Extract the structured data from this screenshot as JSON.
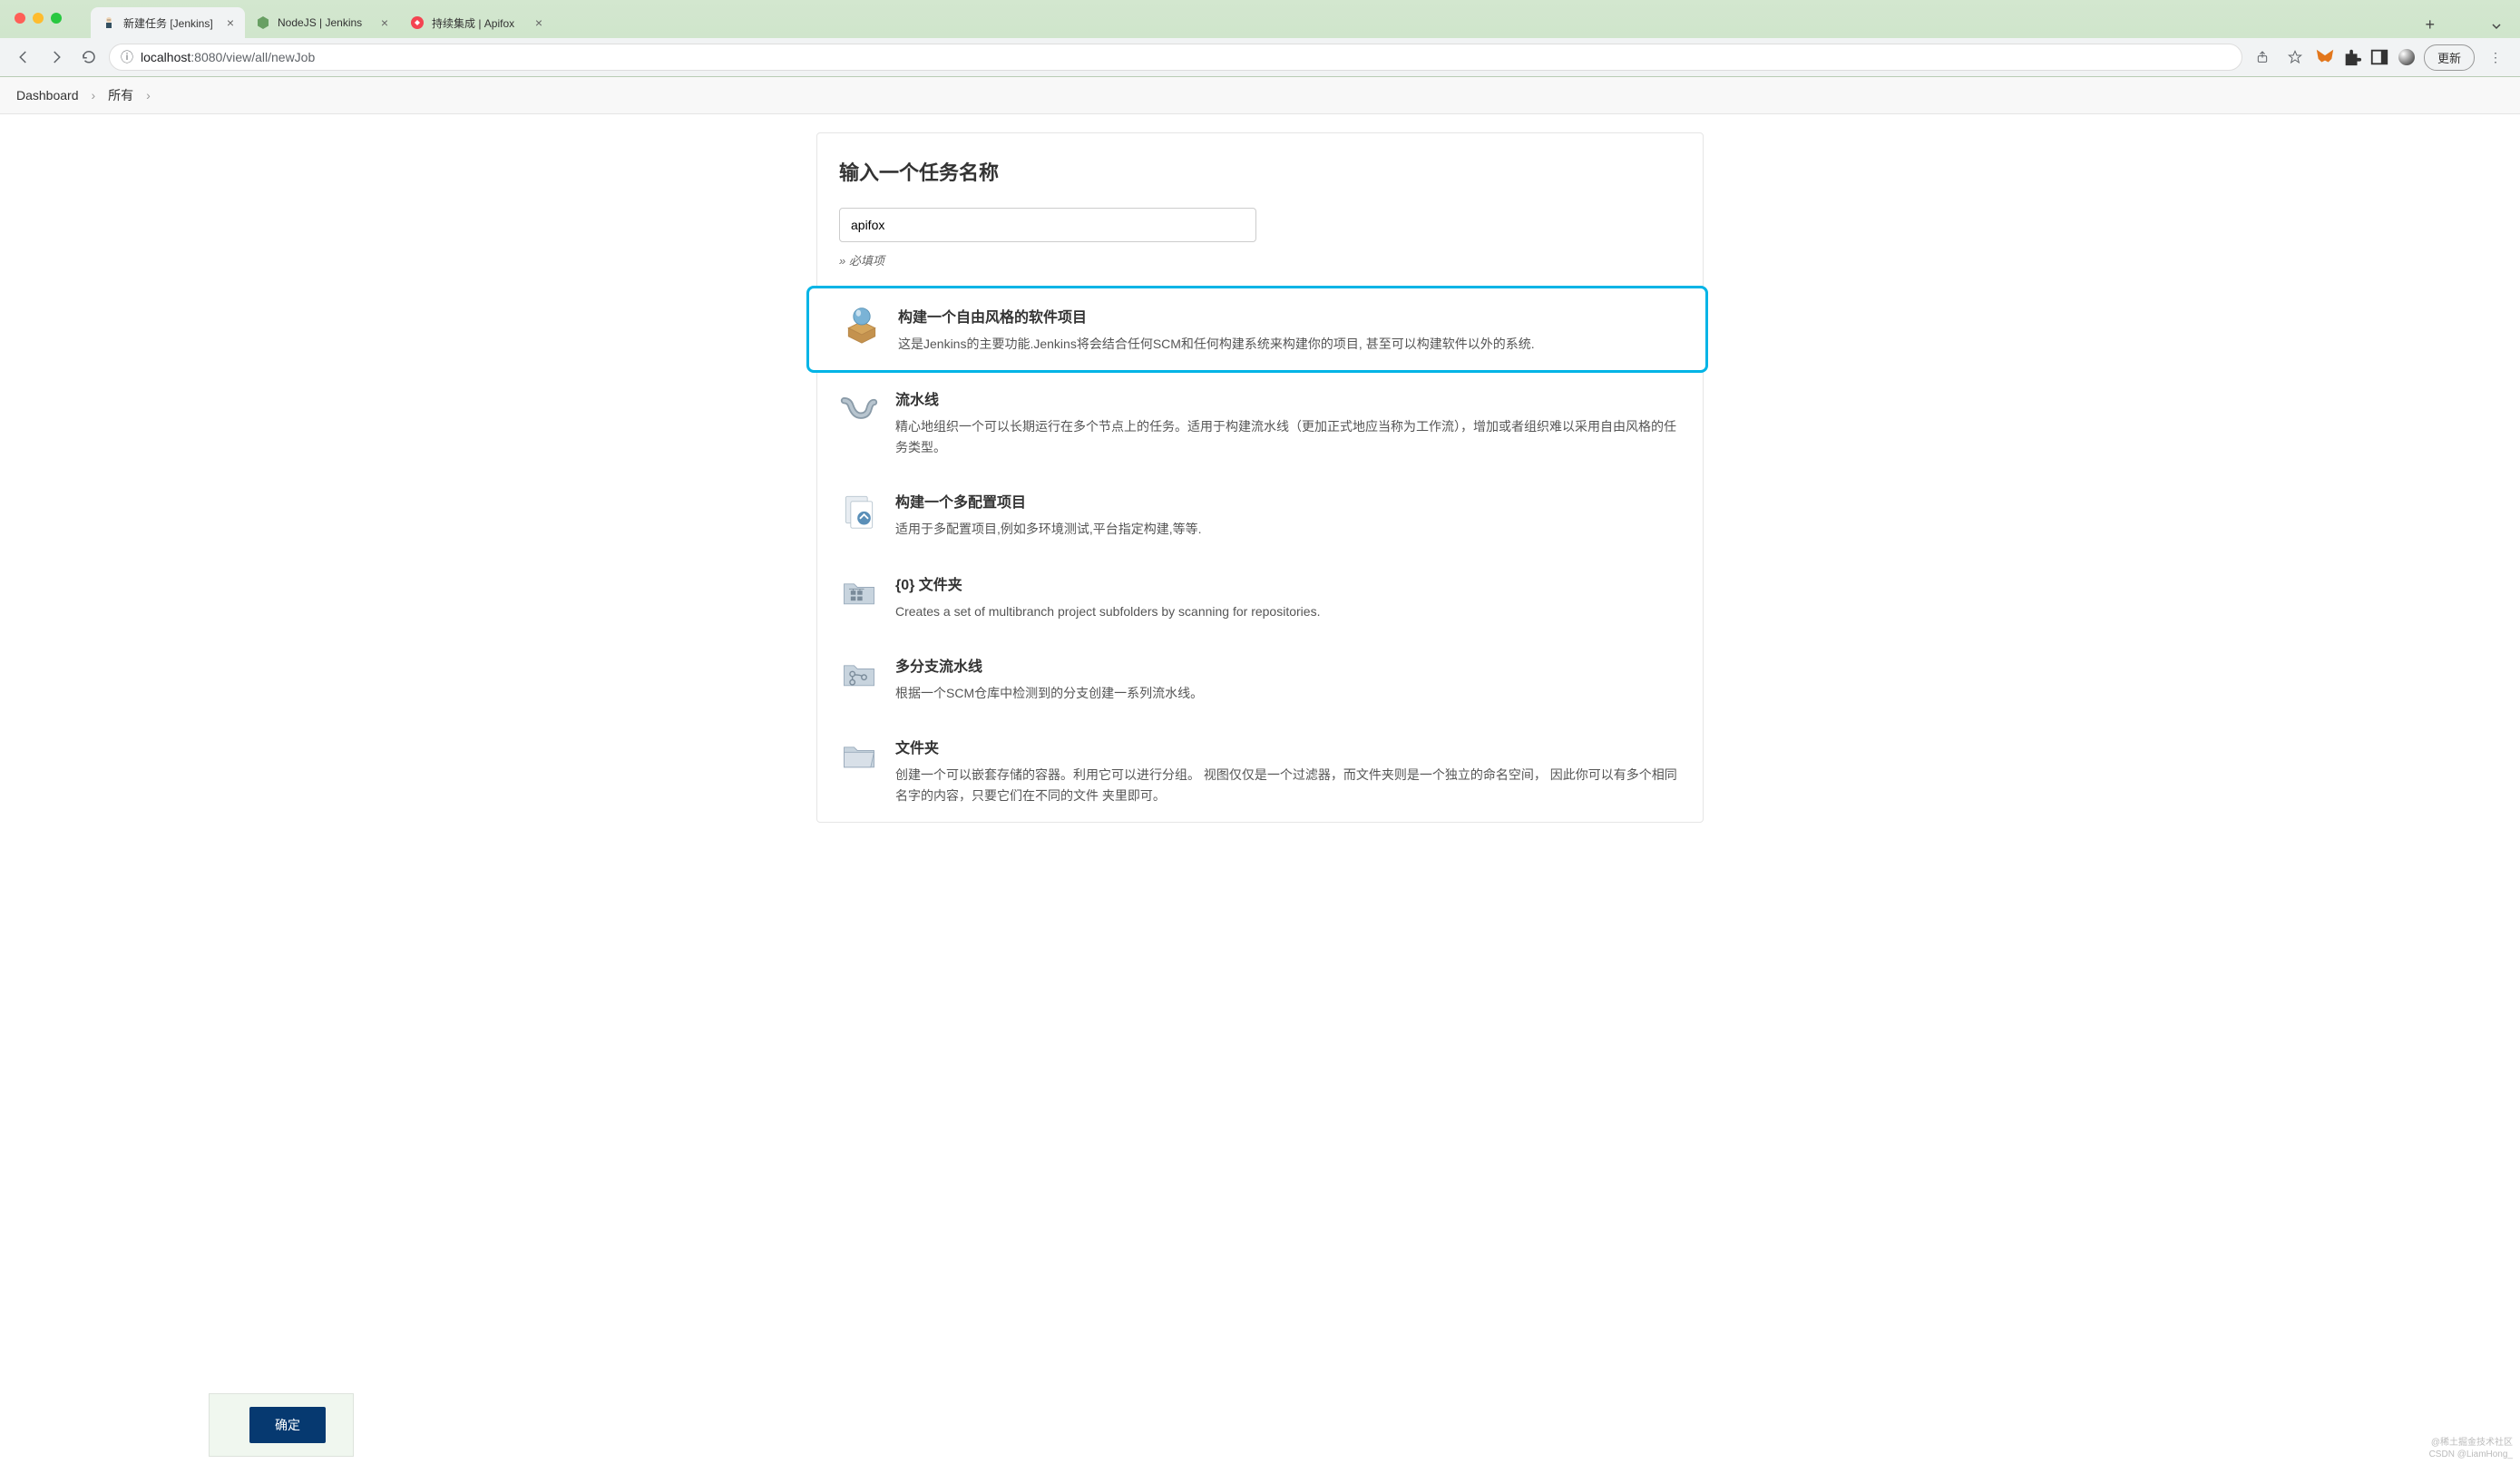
{
  "browser": {
    "tabs": [
      {
        "title": "新建任务 [Jenkins]",
        "favicon_color": "#d33833"
      },
      {
        "title": "NodeJS | Jenkins",
        "favicon_color": "#689f63"
      },
      {
        "title": "持续集成 | Apifox",
        "favicon_color": "#f44451"
      }
    ],
    "url_host": "localhost",
    "url_port": ":8080",
    "url_path": "/view/all/newJob",
    "update_label": "更新"
  },
  "breadcrumb": {
    "items": [
      "Dashboard",
      "所有"
    ]
  },
  "page": {
    "title": "输入一个任务名称",
    "name_value": "apifox",
    "required_hint": "» 必填项",
    "ok_label": "确定"
  },
  "job_types": [
    {
      "title": "构建一个自由风格的软件项目",
      "desc": "这是Jenkins的主要功能.Jenkins将会结合任何SCM和任何构建系统来构建你的项目, 甚至可以构建软件以外的系统.",
      "selected": true
    },
    {
      "title": "流水线",
      "desc": "精心地组织一个可以长期运行在多个节点上的任务。适用于构建流水线（更加正式地应当称为工作流），增加或者组织难以采用自由风格的任务类型。",
      "selected": false
    },
    {
      "title": "构建一个多配置项目",
      "desc": "适用于多配置项目,例如多环境测试,平台指定构建,等等.",
      "selected": false
    },
    {
      "title": "{0} 文件夹",
      "desc": "Creates a set of multibranch project subfolders by scanning for repositories.",
      "selected": false
    },
    {
      "title": "多分支流水线",
      "desc": "根据一个SCM仓库中检测到的分支创建一系列流水线。",
      "selected": false
    },
    {
      "title": "文件夹",
      "desc": "创建一个可以嵌套存储的容器。利用它可以进行分组。 视图仅仅是一个过滤器，而文件夹则是一个独立的命名空间，   因此你可以有多个相同名字的内容，只要它们在不同的文件 夹里即可。",
      "selected": false
    }
  ],
  "watermark": {
    "line1": "@稀土掘金技术社区",
    "line2": "CSDN @LiamHong_"
  }
}
